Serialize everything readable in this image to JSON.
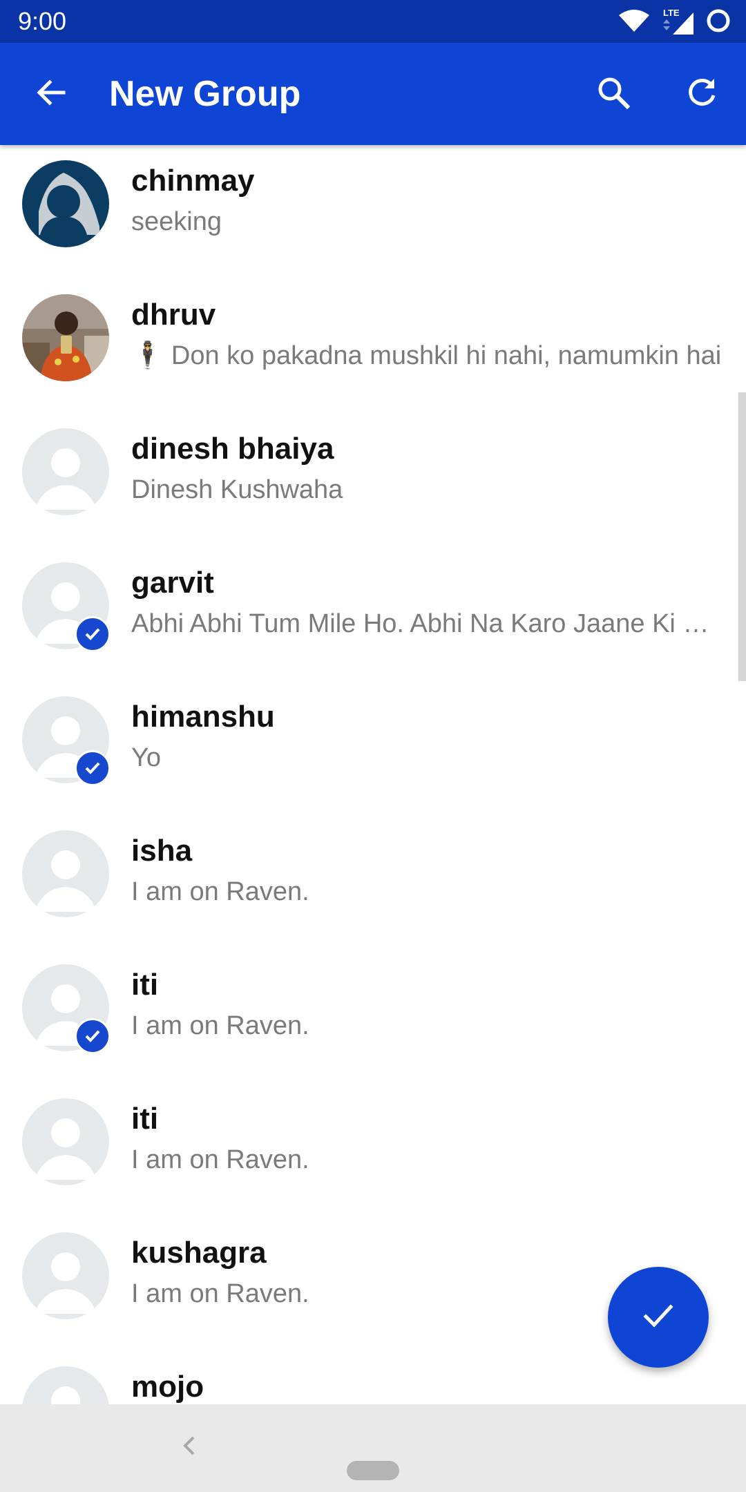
{
  "status_bar": {
    "time": "9:00",
    "network_label": "LTE",
    "icons": [
      "wifi-icon",
      "lte-signal-icon",
      "battery-icon"
    ]
  },
  "app_bar": {
    "title": "New Group",
    "back_icon": "arrow-back-icon",
    "search_icon": "search-icon",
    "refresh_icon": "refresh-icon"
  },
  "contacts": [
    {
      "name": "chinmay",
      "status": "seeking",
      "avatar": "custom-photo",
      "selected": false
    },
    {
      "name": "dhruv",
      "status": "🕴 Don ko pakadna mushkil hi nahi, namumkin hai",
      "avatar": "photo",
      "selected": false
    },
    {
      "name": "dinesh bhaiya",
      "status": "Dinesh Kushwaha",
      "avatar": "default",
      "selected": false
    },
    {
      "name": "garvit",
      "status": "Abhi Abhi Tum Mile Ho. Abhi Na Karo Jaane Ki Baat",
      "avatar": "default",
      "selected": true
    },
    {
      "name": "himanshu",
      "status": "Yo",
      "avatar": "default",
      "selected": true
    },
    {
      "name": "isha",
      "status": "I am on Raven.",
      "avatar": "default",
      "selected": false
    },
    {
      "name": "iti",
      "status": "I am on Raven.",
      "avatar": "default",
      "selected": true
    },
    {
      "name": "iti",
      "status": "I am on Raven.",
      "avatar": "default",
      "selected": false
    },
    {
      "name": "kushagra",
      "status": "I am on Raven.",
      "avatar": "default",
      "selected": false
    },
    {
      "name": "mojo",
      "status": "",
      "avatar": "default",
      "selected": false
    }
  ],
  "fab": {
    "icon": "check-icon"
  },
  "nav_bar": {
    "back_icon": "nav-back-icon",
    "home_icon": "home-pill-icon"
  },
  "colors": {
    "status_bar": "#0a34a6",
    "app_bar": "#0f45d4",
    "accent": "#1648cf",
    "default_avatar_bg": "#e5e9eb",
    "secondary_text": "#7a7a7a"
  }
}
